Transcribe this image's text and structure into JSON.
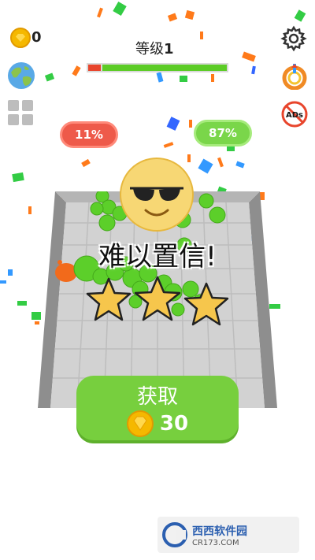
{
  "hud": {
    "coins": "0",
    "level_prefix": "等级",
    "level_number": "1",
    "level_progress_red": 0.09,
    "level_progress_green": 0.91,
    "ads_label": "ADs"
  },
  "stats": {
    "left_percent": "11%",
    "right_percent": "87%"
  },
  "result": {
    "headline": "难以置信!",
    "stars_filled": 3,
    "stars_total": 3
  },
  "reward": {
    "label": "获取",
    "amount": "30"
  },
  "watermark": {
    "brand": "西西软件园",
    "domain": "CR173.COM"
  },
  "colors": {
    "accent_green": "#77cf3e",
    "accent_red": "#ee5a4a",
    "coin_gold": "#f5b800",
    "star_yellow": "#f6c64c"
  },
  "icons": [
    "coin-icon",
    "globe-icon",
    "grid-menu-icon",
    "gear-icon",
    "rate-icon",
    "no-ads-icon",
    "sunglasses-emoji-icon",
    "star-icon"
  ]
}
